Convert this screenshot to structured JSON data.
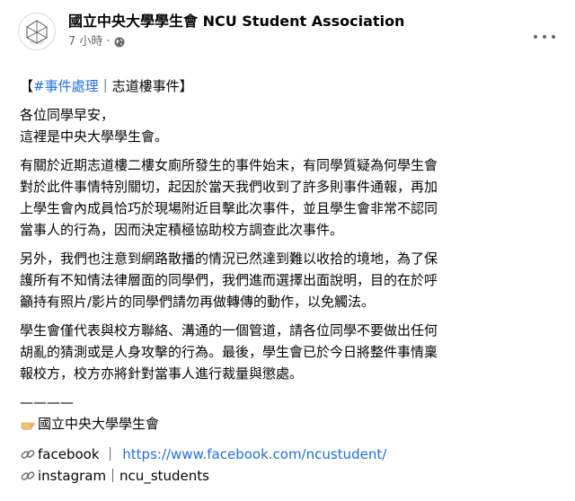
{
  "post": {
    "page_name": "國立中央大學學生會 NCU Student Association",
    "time": "7 小時",
    "dot": "·",
    "avatar_icon": "ncu-logo-icon",
    "privacy_icon": "globe-icon"
  },
  "content": {
    "title_open": "【",
    "title_tag": "#事件處理",
    "title_rest": "｜志道樓事件】",
    "greeting_lines": [
      "各位同學早安，",
      "這裡是中央大學學生會。"
    ],
    "para1_lines": [
      "有關於近期志道樓二樓女廁所發生的事件始末，有同學質疑為何學生會",
      "對於此件事情特別關切，起因於當天我們收到了許多則事件通報，再加",
      "上學生會內成員恰巧於現場附近目擊此次事件，並且學生會非常不認同",
      "當事人的行為，因而決定積極協助校方調查此次事件。"
    ],
    "para2_lines": [
      "另外，我們也注意到網路散播的情況已然達到難以收拾的境地，為了保",
      "護所有不知情法律層面的同學們，我們進而選擇出面說明，目的在於呼",
      "籲持有照片/影片的同學們請勿再做轉傳的動作，以免觸法。"
    ],
    "para3_lines": [
      "學生會僅代表與校方聯絡、溝通的一個管道，請各位同學不要做出任何",
      "胡亂的猜測或是人身攻擊的行為。最後，學生會已於今日將整件事情稟",
      "報校方，校方亦將針對當事人進行裁量與懲處。"
    ],
    "separator": "————",
    "signature": "國立中央大學學生會",
    "facebook_label": "facebook ｜",
    "facebook_url": "https://www.facebook.com/ncustudent/",
    "instagram_label": "instagram｜ncu_students"
  },
  "icons": {
    "more": "more-options-icon",
    "pointing": "pointing-hand-icon",
    "link": "link-icon"
  },
  "colors": {
    "link": "#216fdb",
    "secondary_text": "#65676b"
  }
}
